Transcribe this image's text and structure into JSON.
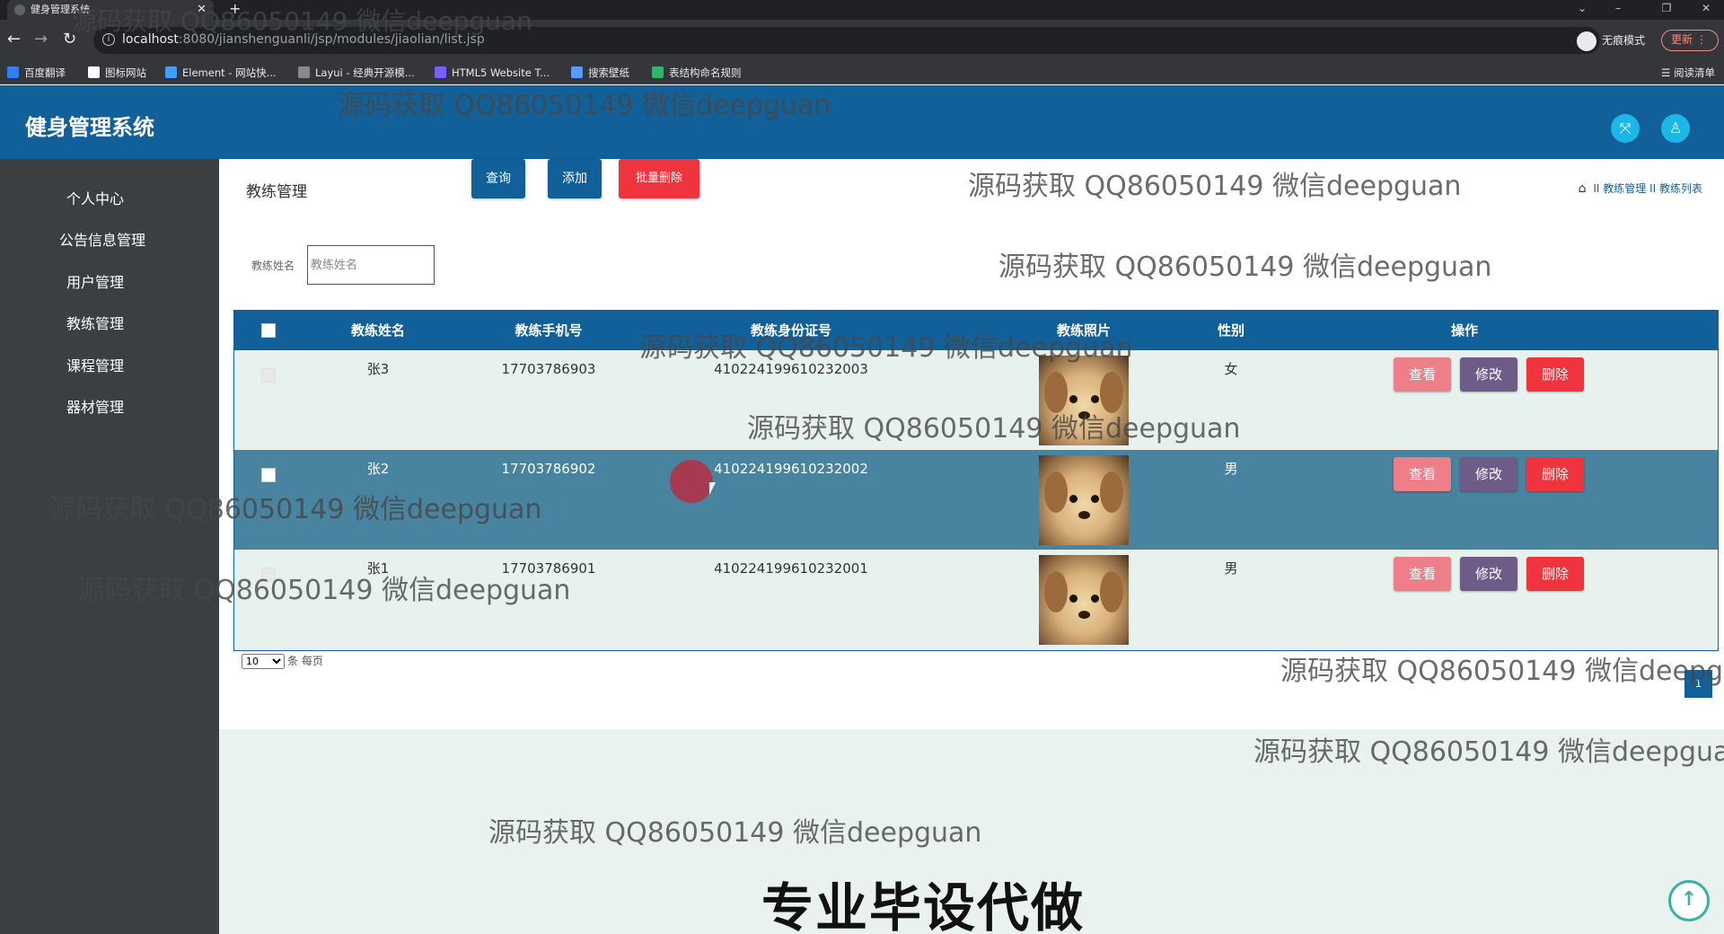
{
  "browser": {
    "tab_title": "健身管理系统",
    "url_host": "localhost",
    "url_path": ":8080/jianshenguanli/jsp/modules/jiaolian/list.jsp",
    "incognito_label": "无痕模式",
    "update_label": "更新",
    "reading_list": "阅读清单",
    "bookmarks": [
      {
        "label": "百度翻译",
        "color": "#2f7ff6"
      },
      {
        "label": "图标网站",
        "color": "#ffffff"
      },
      {
        "label": "Element - 网站快...",
        "color": "#409eff"
      },
      {
        "label": "Layui - 经典开源模...",
        "color": "#e8eaed"
      },
      {
        "label": "HTML5 Website T...",
        "color": "#7b5cff"
      },
      {
        "label": "搜索壁纸",
        "color": "#5b9bff"
      },
      {
        "label": "表结构命名规则",
        "color": "#33b36b"
      }
    ]
  },
  "app": {
    "title": "健身管理系统",
    "header_color": "#12609a"
  },
  "sidebar": {
    "items": [
      {
        "label": "个人中心"
      },
      {
        "label": "公告信息管理"
      },
      {
        "label": "用户管理"
      },
      {
        "label": "教练管理"
      },
      {
        "label": "课程管理"
      },
      {
        "label": "器材管理"
      }
    ]
  },
  "page": {
    "title": "教练管理",
    "breadcrumb": [
      "教练管理",
      "教练列表"
    ],
    "breadcrumb_sep": "II"
  },
  "search": {
    "label": "教练姓名",
    "placeholder": "教练姓名",
    "query_button": "查询",
    "add_button": "添加",
    "batch_delete_button": "批量删除"
  },
  "table": {
    "headers": [
      "教练姓名",
      "教练手机号",
      "教练身份证号",
      "教练照片",
      "性别",
      "操作"
    ],
    "rows": [
      {
        "name": "张3",
        "phone": "17703786903",
        "id_card": "410224199610232003",
        "gender": "女",
        "selected": false
      },
      {
        "name": "张2",
        "phone": "17703786902",
        "id_card": "410224199610232002",
        "gender": "男",
        "selected": true
      },
      {
        "name": "张1",
        "phone": "17703786901",
        "id_card": "410224199610232001",
        "gender": "男",
        "selected": false
      }
    ],
    "actions": {
      "view": "查看",
      "edit": "修改",
      "delete": "删除"
    },
    "colors": {
      "view": "#ee7f89",
      "edit": "#6e5b87",
      "delete": "#f0343e",
      "row_highlight": "#48849f"
    }
  },
  "pagination": {
    "page_size": "10",
    "page_size_suffix": "条 每页",
    "current_page": "1"
  },
  "overlay": {
    "watermark": "源码获取 QQ86050149 微信deepguan",
    "promo": "专业毕设代做"
  }
}
